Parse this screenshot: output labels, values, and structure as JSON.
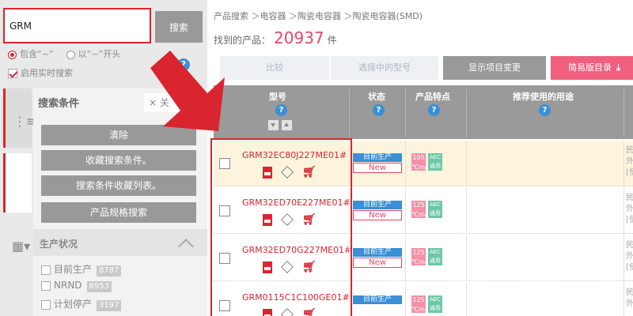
{
  "search": {
    "value": "GRM",
    "button": "搜索",
    "mode_contains": "包含“~”",
    "mode_starts": "以“~”开头",
    "realtime": "启用实时搜索"
  },
  "conditions": {
    "title": "搜索条件",
    "close": "× 关",
    "buttons": [
      "清除",
      "收藏搜索条件。",
      "搜索条件收藏列表。",
      "产品规格搜索"
    ],
    "section": "生产状况",
    "filters": [
      {
        "label": "目前生产",
        "count": "8787"
      },
      {
        "label": "NRND",
        "count": "8953"
      },
      {
        "label": "计划停产",
        "count": "3197"
      }
    ]
  },
  "breadcrumb": "产品搜索 ＞电容器 ＞陶瓷电容器 ＞陶瓷电容器(SMD)",
  "found": {
    "label": "找到的产品：",
    "count": "20937",
    "unit": "件"
  },
  "toolbar": {
    "compare": "比较",
    "select_model": "选择中的型号",
    "show_changes": "显示项目变更",
    "simple_catalog": "简易版目录"
  },
  "columns": {
    "model": "型号",
    "status": "状态",
    "features": "产品特点",
    "usage": "推荐使用的用途"
  },
  "rows": [
    {
      "pn": "GRM32EC80J227ME01#",
      "status": "目前生产",
      "badge": "New",
      "temp": "105",
      "temp_unit": "℃max",
      "aec": "AEC\n通用",
      "use": "民\n外\n[使"
    },
    {
      "pn": "GRM32ED70E227ME01#",
      "status": "目前生产",
      "badge": "New",
      "temp": "125",
      "temp_unit": "℃max",
      "aec": "AEC\n通用",
      "use": "民\n外\n[使"
    },
    {
      "pn": "GRM32ED70G227ME01#",
      "status": "目前生产",
      "badge": "New",
      "temp": "125",
      "temp_unit": "℃max",
      "aec": "AEC\n通用",
      "use": "民\n外\n[使"
    },
    {
      "pn": "GRM0115C1C100GE01#",
      "status": "目前生产",
      "badge": "",
      "temp": "125",
      "temp_unit": "℃max",
      "aec": "AEC\n通用",
      "use": "民\n外"
    }
  ],
  "colors": {
    "accent": "#d9252f",
    "pink": "#f05f7e",
    "blue": "#3a8fd6",
    "green": "#6cc7a6"
  }
}
